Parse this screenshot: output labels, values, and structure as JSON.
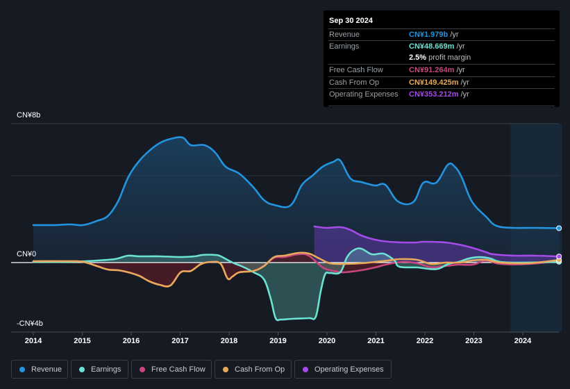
{
  "tooltip": {
    "date": "Sep 30 2024",
    "rows": [
      {
        "label": "Revenue",
        "value": "CN¥1.979b",
        "unit": " /yr",
        "color": "#2394df"
      },
      {
        "label": "Earnings",
        "value": "CN¥48.669m",
        "unit": " /yr",
        "color": "#6ce2d2"
      },
      {
        "label": "",
        "value": "2.5%",
        "unit": " profit margin",
        "color": "#ffffff"
      },
      {
        "label": "Free Cash Flow",
        "value": "CN¥91.264m",
        "unit": " /yr",
        "color": "#c8467f"
      },
      {
        "label": "Cash From Op",
        "value": "CN¥149.425m",
        "unit": " /yr",
        "color": "#e8a95b"
      },
      {
        "label": "Operating Expenses",
        "value": "CN¥353.212m",
        "unit": " /yr",
        "color": "#a54be8"
      }
    ]
  },
  "legend": [
    {
      "label": "Revenue",
      "color": "#2394df"
    },
    {
      "label": "Earnings",
      "color": "#6ce2d2"
    },
    {
      "label": "Free Cash Flow",
      "color": "#c8467f"
    },
    {
      "label": "Cash From Op",
      "color": "#e8a95b"
    },
    {
      "label": "Operating Expenses",
      "color": "#a54be8"
    }
  ],
  "chart_data": {
    "type": "area",
    "title": "",
    "xlabel": "",
    "ylabel": "",
    "y_tick_labels": [
      "CN¥8b",
      "CN¥0",
      "-CN¥4b"
    ],
    "y_ticks": [
      8,
      0,
      -4
    ],
    "ylim": [
      -4,
      8
    ],
    "xlim": [
      2014,
      2024.8
    ],
    "x_tick_labels": [
      "2014",
      "2015",
      "2016",
      "2017",
      "2018",
      "2019",
      "2020",
      "2021",
      "2022",
      "2023",
      "2024"
    ],
    "x_ticks": [
      2014,
      2015,
      2016,
      2017,
      2018,
      2019,
      2020,
      2021,
      2022,
      2023,
      2024
    ],
    "gridlines": [
      8,
      5
    ],
    "highlight_range": [
      2023.75,
      2024.8
    ],
    "units": "CN¥ billions",
    "series": [
      {
        "name": "Revenue",
        "color": "#2394df",
        "fill": true,
        "points": [
          [
            2014.0,
            2.16
          ],
          [
            2014.45,
            2.16
          ],
          [
            2014.74,
            2.2
          ],
          [
            2015.02,
            2.16
          ],
          [
            2015.3,
            2.4
          ],
          [
            2015.52,
            2.68
          ],
          [
            2015.73,
            3.52
          ],
          [
            2015.94,
            4.92
          ],
          [
            2016.16,
            5.84
          ],
          [
            2016.37,
            6.44
          ],
          [
            2016.58,
            6.88
          ],
          [
            2016.8,
            7.12
          ],
          [
            2017.05,
            7.2
          ],
          [
            2017.22,
            6.76
          ],
          [
            2017.5,
            6.76
          ],
          [
            2017.72,
            6.32
          ],
          [
            2017.93,
            5.52
          ],
          [
            2018.21,
            5.12
          ],
          [
            2018.5,
            4.32
          ],
          [
            2018.71,
            3.6
          ],
          [
            2018.92,
            3.32
          ],
          [
            2019.25,
            3.28
          ],
          [
            2019.49,
            4.48
          ],
          [
            2019.7,
            5.0
          ],
          [
            2019.91,
            5.52
          ],
          [
            2020.13,
            5.8
          ],
          [
            2020.27,
            5.88
          ],
          [
            2020.48,
            4.84
          ],
          [
            2020.7,
            4.64
          ],
          [
            2020.98,
            4.44
          ],
          [
            2021.19,
            4.48
          ],
          [
            2021.45,
            3.52
          ],
          [
            2021.76,
            3.48
          ],
          [
            2021.97,
            4.6
          ],
          [
            2022.23,
            4.6
          ],
          [
            2022.47,
            5.64
          ],
          [
            2022.61,
            5.52
          ],
          [
            2022.75,
            4.92
          ],
          [
            2022.96,
            3.52
          ],
          [
            2023.25,
            2.64
          ],
          [
            2023.46,
            2.12
          ],
          [
            2023.82,
            2.0
          ],
          [
            2024.24,
            2.0
          ],
          [
            2024.74,
            1.98
          ]
        ]
      },
      {
        "name": "Earnings",
        "color": "#6ce2d2",
        "fill": true,
        "points": [
          [
            2014.0,
            0.04
          ],
          [
            2014.74,
            0.04
          ],
          [
            2015.52,
            0.16
          ],
          [
            2015.73,
            0.24
          ],
          [
            2015.94,
            0.4
          ],
          [
            2016.16,
            0.36
          ],
          [
            2016.58,
            0.36
          ],
          [
            2017.01,
            0.32
          ],
          [
            2017.3,
            0.36
          ],
          [
            2017.45,
            0.44
          ],
          [
            2017.72,
            0.44
          ],
          [
            2017.83,
            0.36
          ],
          [
            2018.07,
            0.0
          ],
          [
            2018.28,
            -0.24
          ],
          [
            2018.5,
            -0.56
          ],
          [
            2018.71,
            -0.96
          ],
          [
            2018.85,
            -2.08
          ],
          [
            2018.95,
            -3.2
          ],
          [
            2019.06,
            -3.28
          ],
          [
            2019.28,
            -3.24
          ],
          [
            2019.63,
            -3.2
          ],
          [
            2019.77,
            -3.12
          ],
          [
            2019.87,
            -1.68
          ],
          [
            2019.96,
            -0.68
          ],
          [
            2020.06,
            -0.6
          ],
          [
            2020.27,
            -0.56
          ],
          [
            2020.41,
            0.32
          ],
          [
            2020.55,
            0.72
          ],
          [
            2020.7,
            0.8
          ],
          [
            2020.91,
            0.48
          ],
          [
            2021.09,
            0.52
          ],
          [
            2021.19,
            0.48
          ],
          [
            2021.38,
            0.12
          ],
          [
            2021.48,
            -0.24
          ],
          [
            2021.84,
            -0.28
          ],
          [
            2022.06,
            -0.36
          ],
          [
            2022.27,
            -0.36
          ],
          [
            2022.48,
            -0.08
          ],
          [
            2022.69,
            0.04
          ],
          [
            2022.9,
            0.24
          ],
          [
            2023.12,
            0.32
          ],
          [
            2023.33,
            0.24
          ],
          [
            2023.54,
            0.04
          ],
          [
            2023.96,
            0.0
          ],
          [
            2024.74,
            0.05
          ]
        ]
      },
      {
        "name": "Free Cash Flow",
        "color": "#c8467f",
        "fill": true,
        "points": [
          [
            2014.0,
            0.04
          ],
          [
            2014.74,
            0.08
          ],
          [
            2015.02,
            0.04
          ],
          [
            2015.3,
            -0.2
          ],
          [
            2015.52,
            -0.4
          ],
          [
            2015.73,
            -0.44
          ],
          [
            2015.94,
            -0.56
          ],
          [
            2016.16,
            -0.76
          ],
          [
            2016.37,
            -1.08
          ],
          [
            2016.58,
            -1.28
          ],
          [
            2016.8,
            -1.32
          ],
          [
            2017.01,
            -0.56
          ],
          [
            2017.22,
            -0.48
          ],
          [
            2017.43,
            -0.08
          ],
          [
            2017.65,
            0.04
          ],
          [
            2017.83,
            -0.08
          ],
          [
            2017.97,
            -0.92
          ],
          [
            2018.07,
            -0.8
          ],
          [
            2018.21,
            -0.56
          ],
          [
            2018.5,
            -0.48
          ],
          [
            2018.71,
            -0.2
          ],
          [
            2018.92,
            0.28
          ],
          [
            2019.13,
            0.32
          ],
          [
            2019.42,
            0.48
          ],
          [
            2019.63,
            0.4
          ],
          [
            2019.91,
            -0.28
          ],
          [
            2020.13,
            -0.48
          ],
          [
            2020.34,
            -0.56
          ],
          [
            2020.7,
            -0.44
          ],
          [
            2020.98,
            -0.28
          ],
          [
            2021.26,
            -0.08
          ],
          [
            2021.55,
            0.04
          ],
          [
            2021.84,
            -0.04
          ],
          [
            2022.13,
            -0.28
          ],
          [
            2022.41,
            -0.2
          ],
          [
            2022.69,
            -0.12
          ],
          [
            2022.98,
            -0.12
          ],
          [
            2023.25,
            0.12
          ],
          [
            2023.54,
            -0.08
          ],
          [
            2024.11,
            -0.08
          ],
          [
            2024.74,
            0.09
          ]
        ]
      },
      {
        "name": "Cash From Op",
        "color": "#e8a95b",
        "fill": false,
        "points": [
          [
            2014.0,
            0.08
          ],
          [
            2014.74,
            0.08
          ],
          [
            2015.02,
            0.04
          ],
          [
            2015.3,
            -0.2
          ],
          [
            2015.52,
            -0.4
          ],
          [
            2015.73,
            -0.44
          ],
          [
            2015.94,
            -0.56
          ],
          [
            2016.16,
            -0.76
          ],
          [
            2016.37,
            -1.08
          ],
          [
            2016.58,
            -1.28
          ],
          [
            2016.8,
            -1.32
          ],
          [
            2017.01,
            -0.56
          ],
          [
            2017.22,
            -0.48
          ],
          [
            2017.43,
            -0.08
          ],
          [
            2017.65,
            0.04
          ],
          [
            2017.83,
            -0.08
          ],
          [
            2017.97,
            -0.92
          ],
          [
            2018.07,
            -0.8
          ],
          [
            2018.21,
            -0.56
          ],
          [
            2018.5,
            -0.48
          ],
          [
            2018.71,
            -0.2
          ],
          [
            2018.92,
            0.32
          ],
          [
            2019.13,
            0.4
          ],
          [
            2019.42,
            0.56
          ],
          [
            2019.63,
            0.52
          ],
          [
            2019.84,
            0.24
          ],
          [
            2020.06,
            -0.04
          ],
          [
            2020.34,
            -0.08
          ],
          [
            2020.7,
            -0.04
          ],
          [
            2020.98,
            0.04
          ],
          [
            2021.26,
            0.12
          ],
          [
            2021.48,
            0.2
          ],
          [
            2021.84,
            0.16
          ],
          [
            2022.13,
            -0.08
          ],
          [
            2022.41,
            0.0
          ],
          [
            2022.69,
            0.0
          ],
          [
            2022.98,
            0.12
          ],
          [
            2023.25,
            0.16
          ],
          [
            2023.54,
            0.0
          ],
          [
            2024.11,
            -0.04
          ],
          [
            2024.74,
            0.15
          ]
        ]
      },
      {
        "name": "Operating Expenses",
        "color": "#a54be8",
        "fill": true,
        "points": [
          [
            2019.74,
            2.08
          ],
          [
            2019.99,
            2.0
          ],
          [
            2020.27,
            2.04
          ],
          [
            2020.48,
            1.88
          ],
          [
            2020.7,
            1.56
          ],
          [
            2020.98,
            1.32
          ],
          [
            2021.26,
            1.2
          ],
          [
            2021.55,
            1.16
          ],
          [
            2021.84,
            1.16
          ],
          [
            2021.97,
            1.2
          ],
          [
            2022.41,
            1.16
          ],
          [
            2022.69,
            1.04
          ],
          [
            2022.98,
            0.84
          ],
          [
            2023.25,
            0.6
          ],
          [
            2023.4,
            0.48
          ],
          [
            2023.82,
            0.4
          ],
          [
            2024.24,
            0.4
          ],
          [
            2024.74,
            0.35
          ]
        ]
      }
    ]
  }
}
